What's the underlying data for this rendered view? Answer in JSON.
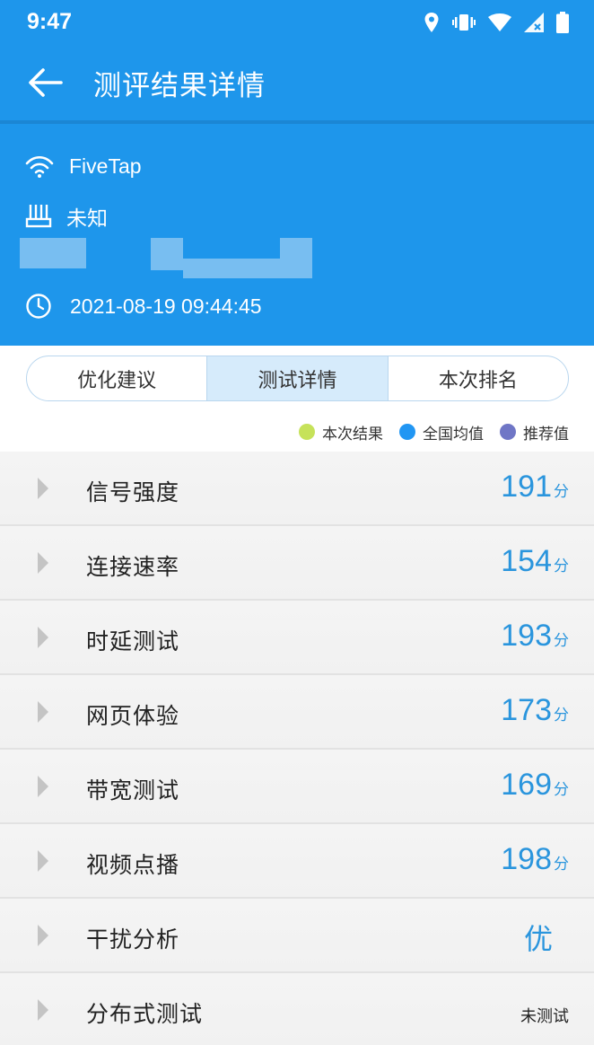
{
  "status_bar": {
    "time": "9:47",
    "icons": [
      "location-icon",
      "vibrate-icon",
      "wifi-icon",
      "cellular-no-signal-icon",
      "battery-icon"
    ]
  },
  "app_bar": {
    "back_icon": "arrow-left-icon",
    "title": "测评结果详情"
  },
  "info": {
    "ssid": "FiveTap",
    "router": "未知",
    "datetime": "2021-08-19 09:44:45"
  },
  "tabs": [
    {
      "label": "优化建议",
      "active": false
    },
    {
      "label": "测试详情",
      "active": true
    },
    {
      "label": "本次排名",
      "active": false
    }
  ],
  "legend": [
    {
      "label": "本次结果",
      "color": "#c6e25a"
    },
    {
      "label": "全国均值",
      "color": "#2196f3"
    },
    {
      "label": "推荐值",
      "color": "#6f76c6"
    }
  ],
  "results": [
    {
      "label": "信号强度",
      "score": "191",
      "unit": "分"
    },
    {
      "label": "连接速率",
      "score": "154",
      "unit": "分"
    },
    {
      "label": "时延测试",
      "score": "193",
      "unit": "分"
    },
    {
      "label": "网页体验",
      "score": "173",
      "unit": "分"
    },
    {
      "label": "带宽测试",
      "score": "169",
      "unit": "分"
    },
    {
      "label": "视频点播",
      "score": "198",
      "unit": "分"
    },
    {
      "label": "干扰分析",
      "grade": "优"
    },
    {
      "label": "分布式测试",
      "status": "未测试"
    }
  ],
  "colors": {
    "primary": "#1e96eb",
    "score": "#2a95dd",
    "active_tab": "#d6ebfb",
    "list_bg": "#f3f3f3"
  }
}
